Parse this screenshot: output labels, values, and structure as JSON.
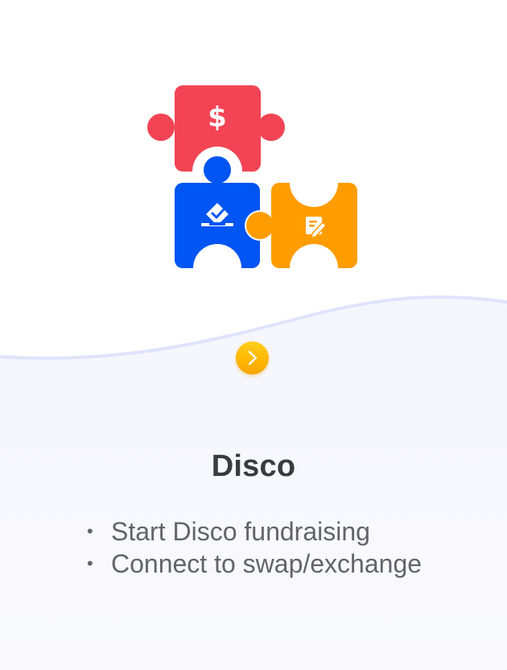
{
  "intro": {
    "title": "Disco",
    "bullets": [
      "Start Disco fundraising",
      "Connect to swap/exchange"
    ]
  },
  "icons": {
    "hero": "puzzle-pieces-icon",
    "money": "dollar-icon",
    "vote": "ballot-box-icon",
    "note": "document-edit-icon",
    "next": "chevron-right-icon"
  },
  "colors": {
    "red": "#f24454",
    "blue": "#0055f3",
    "orange": "#ff9d00",
    "yellow": "#ffc107",
    "wave_line": "#dfe3fb",
    "wave_fill": "#f7f8fd"
  }
}
